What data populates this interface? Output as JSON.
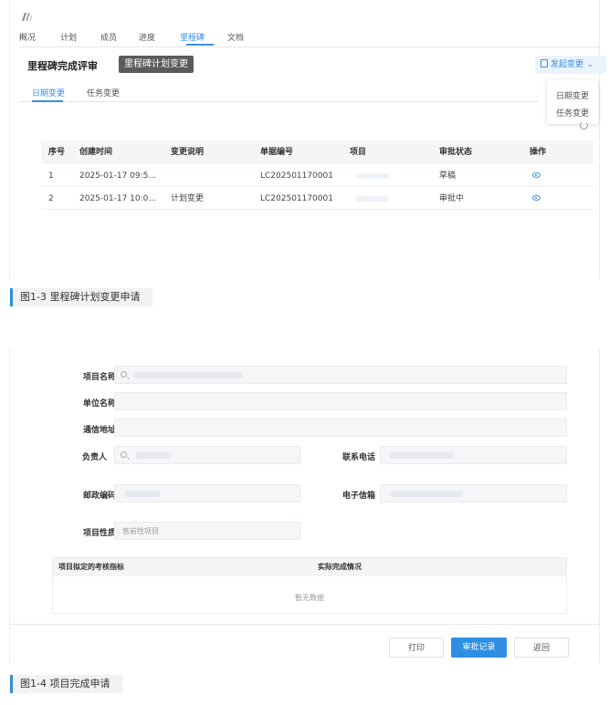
{
  "shot1": {
    "main_tabs": [
      "概况",
      "计划",
      "成员",
      "进度",
      "里程碑",
      "文档"
    ],
    "page_title": "里程碑完成评审",
    "subtitle_chip": "里程碑计划变更",
    "initiate_change": "发起变更",
    "dropdown_items": [
      "日期变更",
      "任务变更"
    ],
    "sub_tabs": [
      "日期变更",
      "任务变更"
    ],
    "table": {
      "headers": [
        "序号",
        "创建时间",
        "变更说明",
        "单据编号",
        "项目",
        "审批状态",
        "操作"
      ],
      "rows": [
        [
          "1",
          "2025-01-17 09:5...",
          "",
          "LC202501170001",
          "",
          "草稿"
        ],
        [
          "2",
          "2025-01-17 10:0...",
          "计划变更",
          "LC202501170001",
          "",
          "审批中"
        ]
      ]
    },
    "accent_color": "#3a8ee6"
  },
  "caption1": "图1-3 里程碑计划变更申请",
  "shot2": {
    "labels": {
      "project_name": "项目名称",
      "unit_name": "单位名称",
      "address": "通信地址",
      "owner": "负责人",
      "phone": "联系电话",
      "postal_code": "邮政编码",
      "email": "电子信箱",
      "nature": "项目性质"
    },
    "nature_value": "售前性项目",
    "indicator_table": {
      "headers": [
        "项目拟定的考核指标",
        "实际完成情况"
      ],
      "empty": "暂无数据"
    },
    "buttons": {
      "print": "打印",
      "approval_log": "审批记录",
      "back": "返回"
    }
  },
  "caption2": "图1-4 项目完成申请"
}
